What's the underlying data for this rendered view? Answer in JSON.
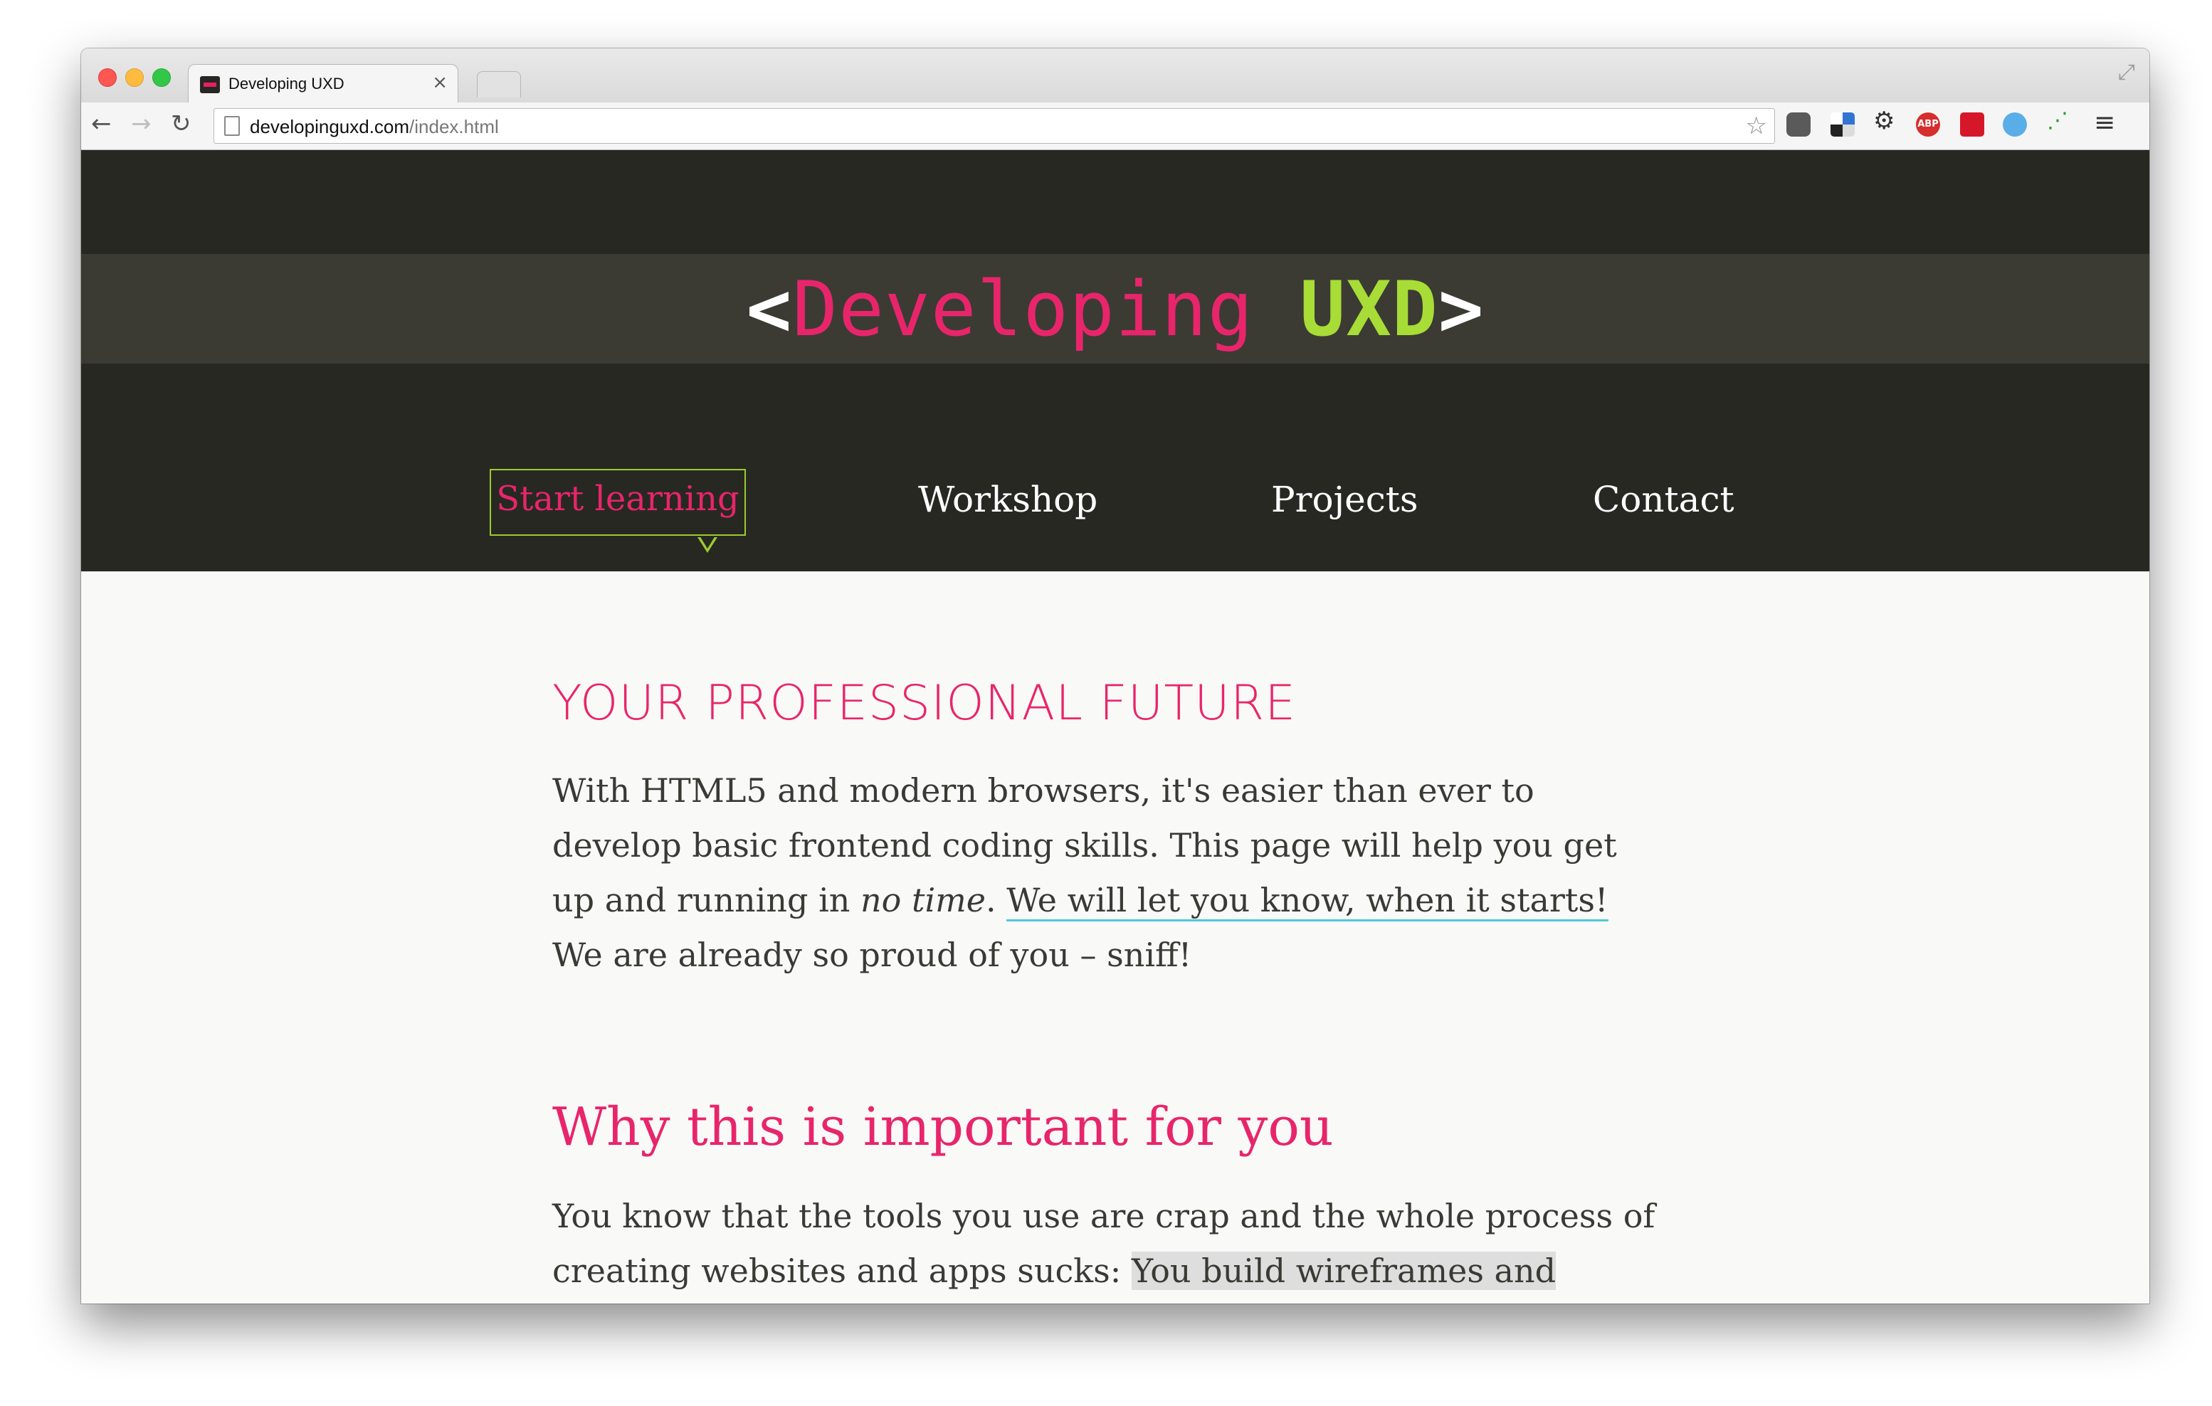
{
  "browser": {
    "tab_title": "Developing UXD",
    "tab_close": "×",
    "url_domain": "developinguxd.com",
    "url_path": "/index.html",
    "star_icon": "☆",
    "menu_icon": "≡",
    "extensions": [
      "pocket-icon",
      "delicious-icon",
      "gear-icon",
      "adblock-plus-icon",
      "red-extension-icon",
      "blue-extension-icon",
      "chart-icon"
    ],
    "abp_label": "ABP"
  },
  "site": {
    "logo": {
      "open": "<",
      "developing": "Developing",
      "uxd": "UXD",
      "close": ">"
    },
    "nav": [
      {
        "label": "Start learning",
        "active": true
      },
      {
        "label": "Workshop"
      },
      {
        "label": "Projects"
      },
      {
        "label": "Contact"
      }
    ],
    "colors": {
      "header_bg": "#282823",
      "band_bg": "#3b3b34",
      "accent_pink": "#e8256b",
      "accent_green": "#a8dc36",
      "link_underline": "#4fc9d6"
    }
  },
  "content": {
    "heading1": "YOUR PROFESSIONAL FUTURE",
    "para1": {
      "part1": "With HTML5 and modern browsers, it's easier than ever to develop basic frontend coding skills. This page will help you get up and running in ",
      "em": "no time",
      "part2": ". ",
      "link": "We will let you know, when it starts!",
      "part3": " We are already so proud of you – sniff!"
    },
    "heading2": "Why this is important for you",
    "para2": {
      "part1": "You know that the tools you use are crap and the whole process of creating websites and apps sucks: ",
      "highlight": "You build wireframes and"
    }
  }
}
